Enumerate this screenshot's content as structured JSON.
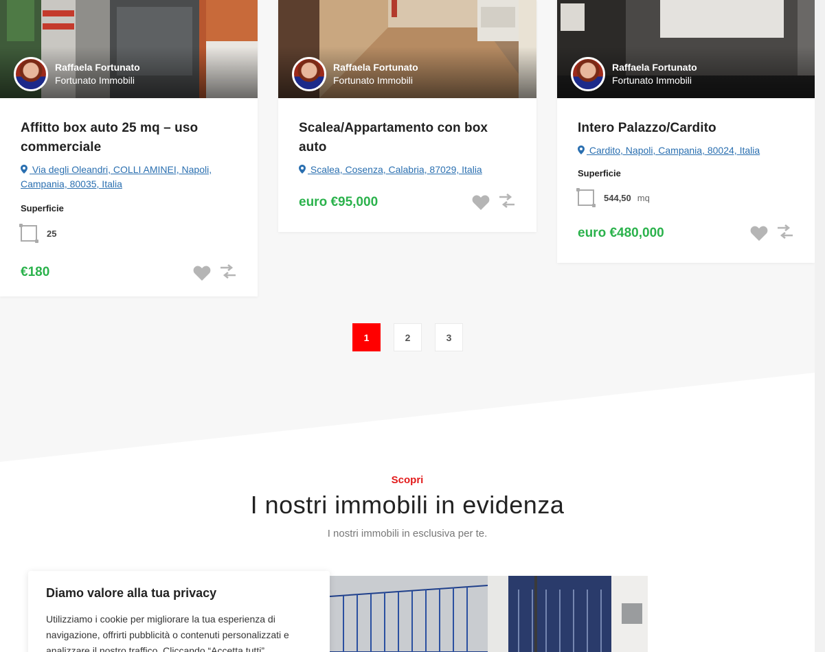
{
  "cards": [
    {
      "agent_name": "Raffaela Fortunato",
      "agent_company": "Fortunato Immobili",
      "title": "Affitto box auto 25 mq – uso commerciale",
      "address": "Via degli Oleandri, COLLI AMINEI, Napoli, Campania, 80035, Italia",
      "feature_label": "Superficie",
      "area_value": "25",
      "area_unit": "",
      "price": "€180"
    },
    {
      "agent_name": "Raffaela Fortunato",
      "agent_company": "Fortunato Immobili",
      "title": "Scalea/Appartamento con box auto",
      "address": "Scalea, Cosenza, Calabria, 87029, Italia",
      "price": "euro €95,000"
    },
    {
      "agent_name": "Raffaela Fortunato",
      "agent_company": "Fortunato Immobili",
      "title": "Intero Palazzo/Cardito",
      "address": "Cardito, Napoli, Campania, 80024, Italia",
      "feature_label": "Superficie",
      "area_value": "544,50",
      "area_unit": "mq",
      "price": "euro €480,000"
    }
  ],
  "pagination": {
    "pages": [
      "1",
      "2",
      "3"
    ],
    "current": "1"
  },
  "featured": {
    "kicker": "Scopri",
    "title": "I nostri immobili in evidenza",
    "subtitle": "I nostri immobili in esclusiva per te."
  },
  "privacy": {
    "title": "Diamo valore alla tua privacy",
    "text": "Utilizziamo i cookie per migliorare la tua esperienza di navigazione, offrirti pubblicità o contenuti personalizzati e analizzare il nostro traffico. Cliccando “Accetta tutti”"
  },
  "colors": {
    "accent_red": "#ff0000",
    "price_green": "#2bb24c",
    "link_blue": "#2a6fb0"
  }
}
